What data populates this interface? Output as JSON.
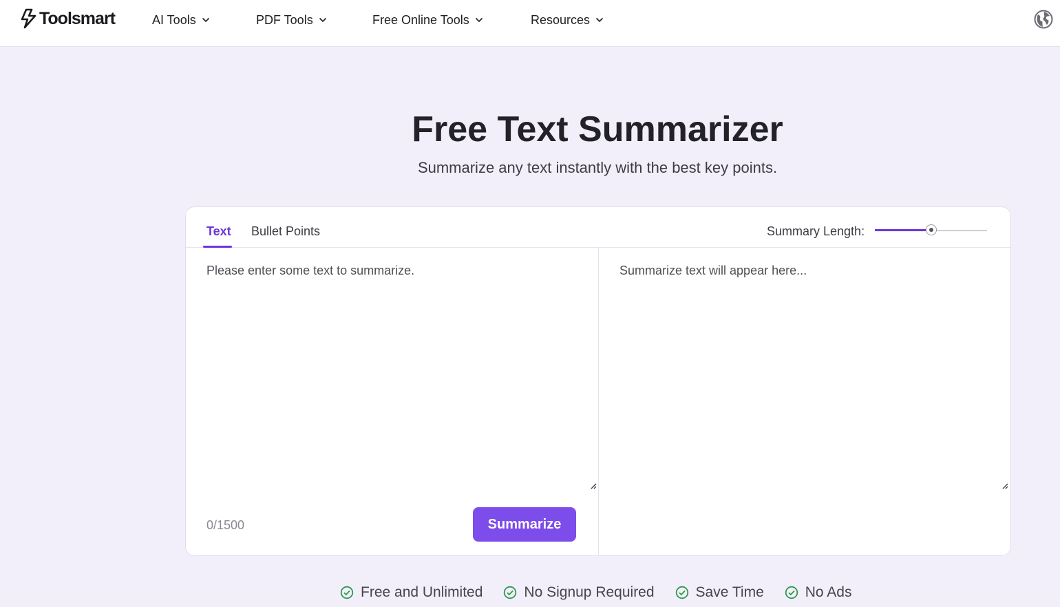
{
  "header": {
    "brand": "Toolsmart",
    "nav": [
      {
        "label": "AI Tools"
      },
      {
        "label": "PDF Tools"
      },
      {
        "label": "Free Online Tools"
      },
      {
        "label": "Resources"
      }
    ],
    "language_icon": "globe-icon"
  },
  "hero": {
    "title": "Free Text Summarizer",
    "subtitle": "Summarize any text instantly with the best key points."
  },
  "summarizer": {
    "tabs": [
      {
        "label": "Text",
        "active": true
      },
      {
        "label": "Bullet Points",
        "active": false
      }
    ],
    "summary_length_label": "Summary Length:",
    "summary_length_value": 0.5,
    "input_placeholder": "Please enter some text to summarize.",
    "input_value": "",
    "output_placeholder": "Summarize text will appear here...",
    "char_counter": "0/1500",
    "summarize_button": "Summarize"
  },
  "features": [
    {
      "label": "Free and Unlimited",
      "icon": "check-circle-icon"
    },
    {
      "label": "No Signup Required",
      "icon": "check-circle-icon"
    },
    {
      "label": "Save Time",
      "icon": "check-circle-icon"
    },
    {
      "label": "No Ads",
      "icon": "check-circle-icon"
    }
  ],
  "colors": {
    "accent": "#6b35d9",
    "button": "#7c4dea",
    "page_background": "#f2effb",
    "check_green": "#2e9a4a"
  }
}
